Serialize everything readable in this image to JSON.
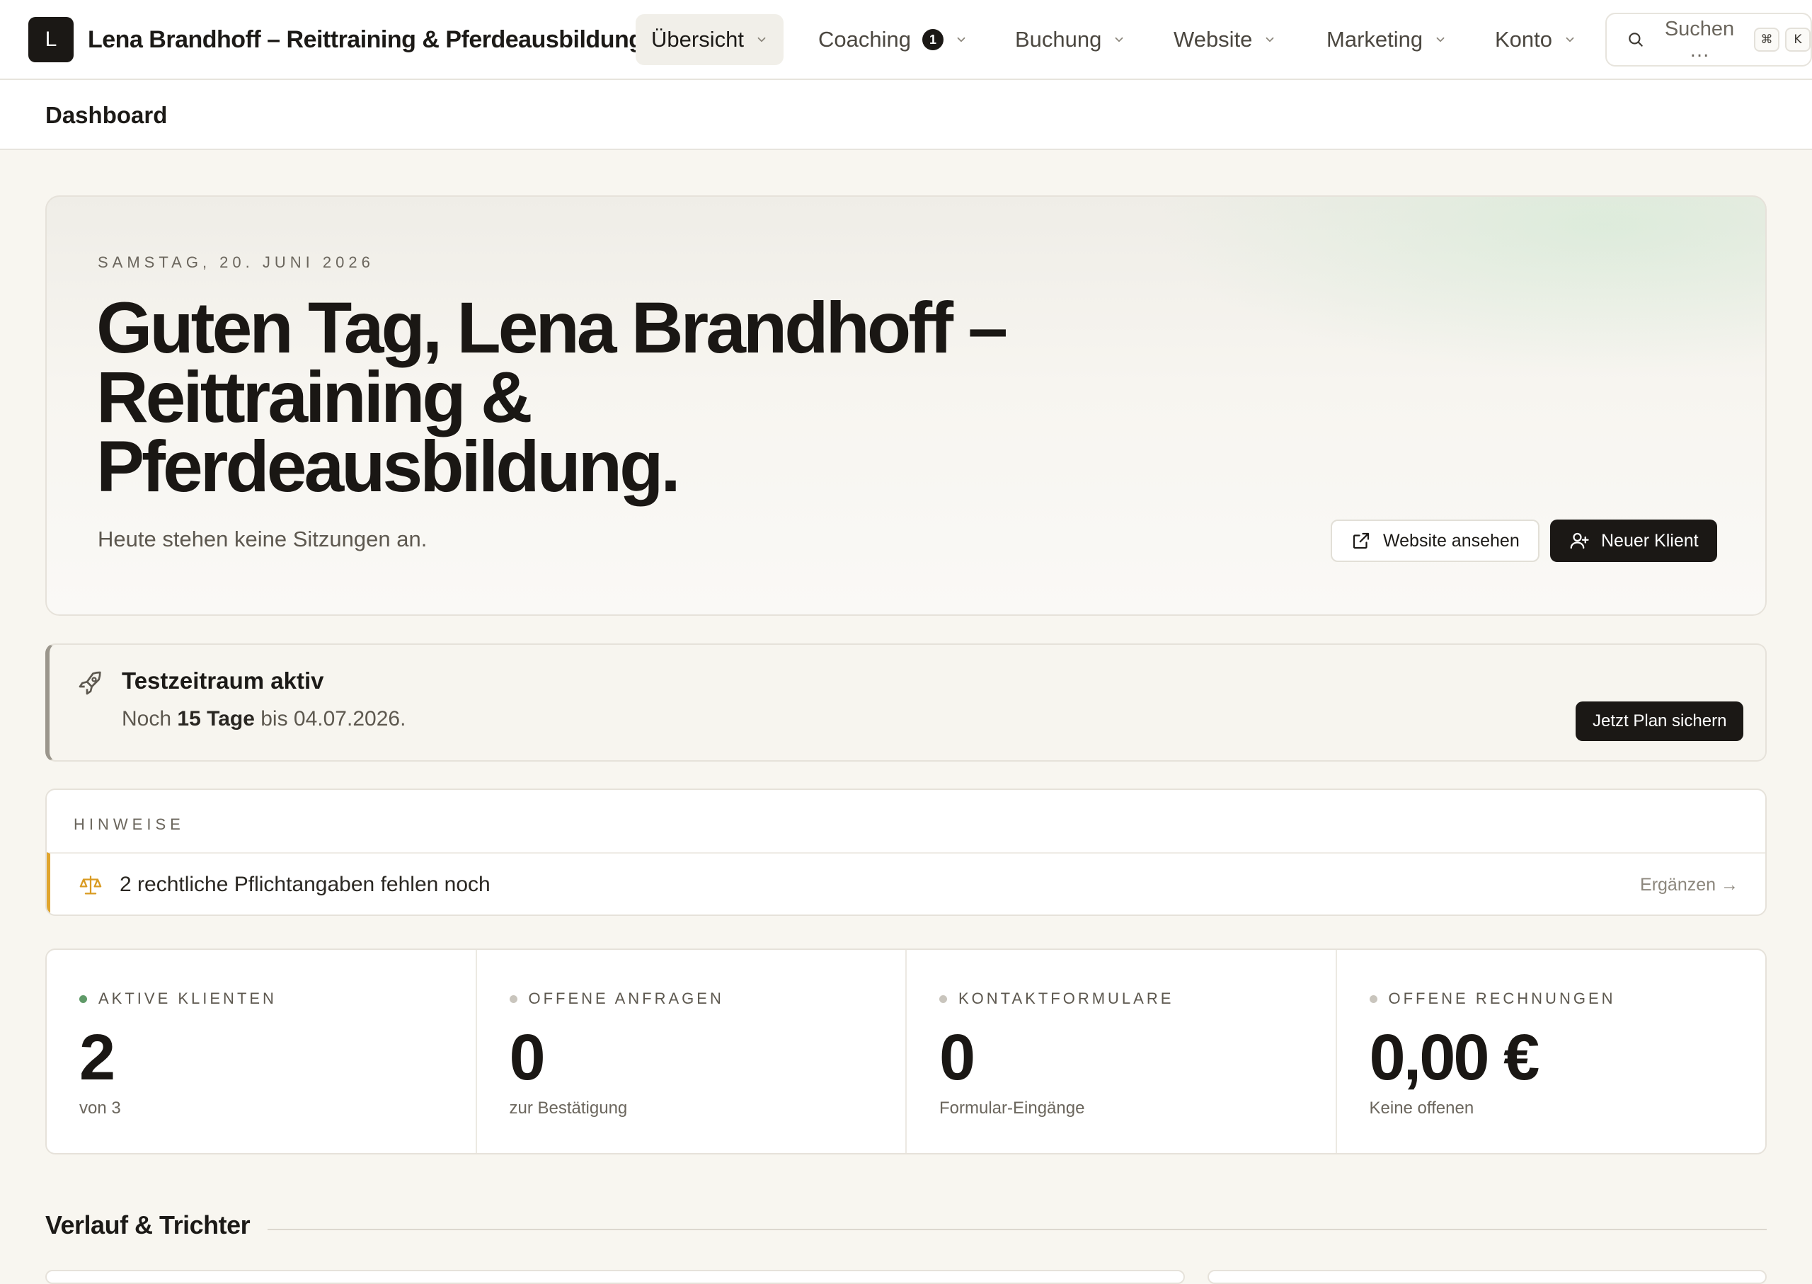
{
  "topbar": {
    "logo_letter": "L",
    "brand": "Lena Brandhoff – Reittraining & Pferdeausbildung",
    "nav": [
      {
        "label": "Übersicht",
        "active": true
      },
      {
        "label": "Coaching",
        "badge": "1"
      },
      {
        "label": "Buchung"
      },
      {
        "label": "Website"
      },
      {
        "label": "Marketing"
      },
      {
        "label": "Konto"
      }
    ],
    "search": {
      "label": "Suchen …",
      "shortcut_mod": "⌘",
      "shortcut_key": "K"
    }
  },
  "page": {
    "title": "Dashboard"
  },
  "hero": {
    "date": "SAMSTAG, 20. JUNI 2026",
    "greeting": "Guten Tag, Lena Brandhoff – Reittraining & Pferdeausbildung.",
    "subtitle": "Heute stehen keine Sitzungen an.",
    "btn_website": "Website ansehen",
    "btn_new_client": "Neuer Klient"
  },
  "trial": {
    "title": "Testzeitraum aktiv",
    "text_prefix": "Noch",
    "days": "15 Tage",
    "text_suffix": "bis 04.07.2026.",
    "cta": "Jetzt Plan sichern"
  },
  "hints": {
    "heading": "HINWEISE",
    "items": [
      {
        "text": "2 rechtliche Pflichtangaben fehlen noch",
        "action": "Ergänzen →"
      }
    ]
  },
  "stats": [
    {
      "label": "AKTIVE KLIENTEN",
      "value": "2",
      "sub": "von 3",
      "dot_color": "#5f9a68"
    },
    {
      "label": "OFFENE ANFRAGEN",
      "value": "0",
      "sub": "zur Bestätigung",
      "dot_color": "#c9c5bd"
    },
    {
      "label": "KONTAKTFORMULARE",
      "value": "0",
      "sub": "Formular-Eingänge",
      "dot_color": "#c9c5bd"
    },
    {
      "label": "OFFENE RECHNUNGEN",
      "value": "0,00 €",
      "sub": "Keine offenen",
      "dot_color": "#c9c5bd"
    }
  ],
  "section": {
    "title": "Verlauf & Trichter"
  },
  "colors": {
    "dark": "#1b1815",
    "accent_warning": "#e0a52e",
    "background": "#f8f6f0"
  }
}
